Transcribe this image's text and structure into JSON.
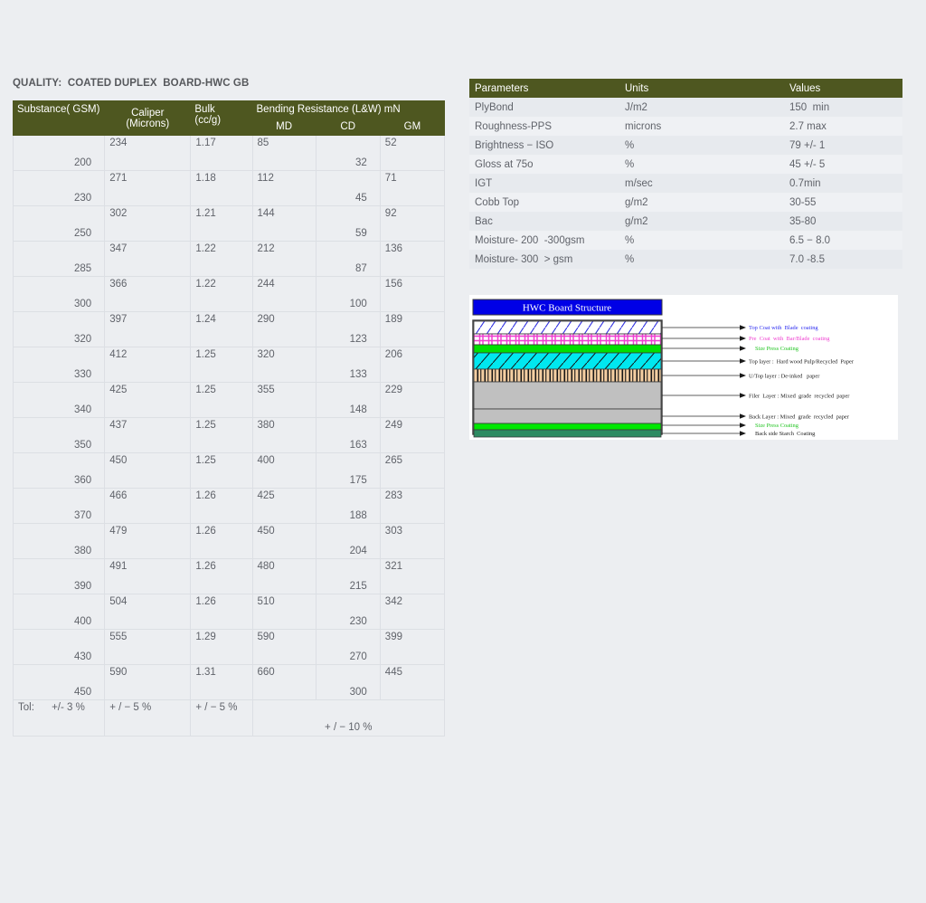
{
  "quality_title": "QUALITY:  COATED DUPLEX  BOARD-HWC GB",
  "substance_table": {
    "headers": {
      "gsm": "Substance( GSM)",
      "caliper_line1": "Caliper",
      "caliper_line2": "(Microns)",
      "bulk_line1": "Bulk",
      "bulk_line2": "(cc/g)",
      "bending": "Bending Resistance (L&W) mN",
      "md": "MD",
      "cd": "CD",
      "gm": "GM"
    },
    "rows": [
      {
        "gsm": "200",
        "caliper": "234",
        "bulk": "1.17",
        "md": "85",
        "cd": "32",
        "gm": "52"
      },
      {
        "gsm": "230",
        "caliper": "271",
        "bulk": "1.18",
        "md": "112",
        "cd": "45",
        "gm": "71"
      },
      {
        "gsm": "250",
        "caliper": "302",
        "bulk": "1.21",
        "md": "144",
        "cd": "59",
        "gm": "92"
      },
      {
        "gsm": "285",
        "caliper": "347",
        "bulk": "1.22",
        "md": "212",
        "cd": "87",
        "gm": "136"
      },
      {
        "gsm": "300",
        "caliper": "366",
        "bulk": "1.22",
        "md": "244",
        "cd": "100",
        "gm": "156"
      },
      {
        "gsm": "320",
        "caliper": "397",
        "bulk": "1.24",
        "md": "290",
        "cd": "123",
        "gm": "189"
      },
      {
        "gsm": "330",
        "caliper": "412",
        "bulk": "1.25",
        "md": "320",
        "cd": "133",
        "gm": "206"
      },
      {
        "gsm": "340",
        "caliper": "425",
        "bulk": "1.25",
        "md": "355",
        "cd": "148",
        "gm": "229"
      },
      {
        "gsm": "350",
        "caliper": "437",
        "bulk": "1.25",
        "md": "380",
        "cd": "163",
        "gm": "249"
      },
      {
        "gsm": "360",
        "caliper": "450",
        "bulk": "1.25",
        "md": "400",
        "cd": "175",
        "gm": "265"
      },
      {
        "gsm": "370",
        "caliper": "466",
        "bulk": "1.26",
        "md": "425",
        "cd": "188",
        "gm": "283"
      },
      {
        "gsm": "380",
        "caliper": "479",
        "bulk": "1.26",
        "md": "450",
        "cd": "204",
        "gm": "303"
      },
      {
        "gsm": "390",
        "caliper": "491",
        "bulk": "1.26",
        "md": "480",
        "cd": "215",
        "gm": "321"
      },
      {
        "gsm": "400",
        "caliper": "504",
        "bulk": "1.26",
        "md": "510",
        "cd": "230",
        "gm": "342"
      },
      {
        "gsm": "430",
        "caliper": "555",
        "bulk": "1.29",
        "md": "590",
        "cd": "270",
        "gm": "399"
      },
      {
        "gsm": "450",
        "caliper": "590",
        "bulk": "1.31",
        "md": "660",
        "cd": "300",
        "gm": "445"
      }
    ],
    "tolerance": {
      "label": "Tol:      +/- 3 %",
      "caliper": "+ / − 5 %",
      "bulk": "+ / − 5 %",
      "bending": "+ / − 10 %"
    }
  },
  "params_table": {
    "headers": {
      "parameters": "Parameters",
      "units": "Units",
      "values": "Values"
    },
    "rows": [
      {
        "parameter": "PlyBond",
        "unit": "J/m2",
        "value": "150  min"
      },
      {
        "parameter": "Roughness-PPS",
        "unit": "microns",
        "value": "2.7 max"
      },
      {
        "parameter": "Brightness − ISO",
        "unit": "%",
        "value": "79 +/- 1"
      },
      {
        "parameter": "Gloss at 75o",
        "unit": "%",
        "value": "45 +/- 5"
      },
      {
        "parameter": "IGT",
        "unit": "m/sec",
        "value": "0.7min"
      },
      {
        "parameter": "Cobb Top",
        "unit": "g/m2",
        "value": "30-55"
      },
      {
        "parameter": "Bac",
        "unit": "g/m2",
        "value": "35-80"
      },
      {
        "parameter": "Moisture- 200  -300gsm",
        "unit": "%",
        "value": "6.5 − 8.0"
      },
      {
        "parameter": "Moisture- 300  > gsm",
        "unit": "%",
        "value": "7.0 -8.5"
      }
    ]
  },
  "diagram": {
    "title": "HWC Board  Structure",
    "title_bg": "#0000e6",
    "labels": [
      {
        "text": "Top Coat with  Blade  coating",
        "color": "blue"
      },
      {
        "text": "Pre  Coat  with  Bar/Blade  coating",
        "color": "pink"
      },
      {
        "text": "Size Press Coating",
        "color": "green"
      },
      {
        "text": "Top layer :  Hard wood Pulp/Recycled  Paper",
        "color": "dark"
      },
      {
        "text": "U/Top layer : De-inked   paper",
        "color": "dark"
      },
      {
        "text": "Filer  Layer : Mixed  grade  recycled  paper",
        "color": "dark"
      },
      {
        "text": "Back Layer : Mixed  grade  recycled  paper",
        "color": "dark"
      },
      {
        "text": "Size Press Coating",
        "color": "green"
      },
      {
        "text": "Back side Starch  Coating",
        "color": "dark"
      }
    ],
    "layers": [
      {
        "name": "top-coat-layer",
        "fill": "#ffffff",
        "pattern": "diag-blue"
      },
      {
        "name": "pre-coat-layer",
        "fill": "#ffffff",
        "pattern": "pink-dash"
      },
      {
        "name": "size-press-layer",
        "fill": "#00e000",
        "pattern": "none"
      },
      {
        "name": "top-pulp-layer",
        "fill": "#00e8f0",
        "pattern": "diag-dark"
      },
      {
        "name": "deinked-layer",
        "fill": "#f5ceа0",
        "pattern": "vert-bars"
      },
      {
        "name": "filler-layer",
        "fill": "#c0c0c0",
        "pattern": "none"
      },
      {
        "name": "back-layer",
        "fill": "#c0c0c0",
        "pattern": "none"
      },
      {
        "name": "size-press-back",
        "fill": "#00e800",
        "pattern": "none"
      },
      {
        "name": "starch-coat-layer",
        "fill": "#2e8b62",
        "pattern": "none"
      }
    ]
  }
}
